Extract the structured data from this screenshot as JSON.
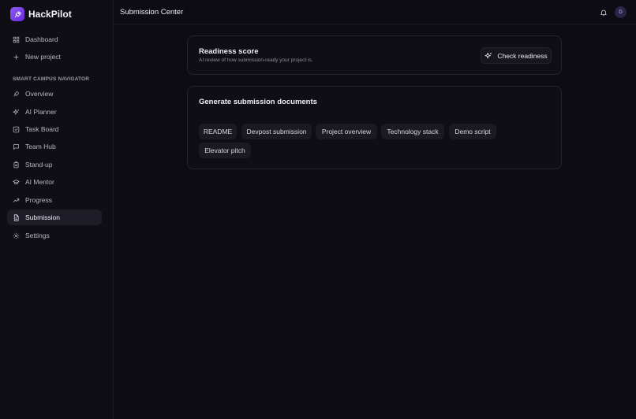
{
  "brand": {
    "name": "HackPilot",
    "logo_icon": "rocket-icon",
    "accent": "#8b5cf6"
  },
  "sidebar": {
    "top_items": [
      {
        "label": "Dashboard",
        "icon": "grid-icon"
      },
      {
        "label": "New project",
        "icon": "plus-icon"
      }
    ],
    "section_label": "SMART CAMPUS NAVIGATOR",
    "project_items": [
      {
        "label": "Overview",
        "icon": "rocket-icon"
      },
      {
        "label": "AI Planner",
        "icon": "sparkles-icon"
      },
      {
        "label": "Task Board",
        "icon": "checklist-icon"
      },
      {
        "label": "Team Hub",
        "icon": "chat-icon"
      },
      {
        "label": "Stand-up",
        "icon": "clipboard-icon"
      },
      {
        "label": "AI Mentor",
        "icon": "graduation-cap-icon"
      },
      {
        "label": "Progress",
        "icon": "trend-up-icon"
      },
      {
        "label": "Submission",
        "icon": "file-icon",
        "active": true
      },
      {
        "label": "Settings",
        "icon": "gear-icon"
      }
    ]
  },
  "header": {
    "title": "Submission Center",
    "avatar_initial": "D"
  },
  "readiness": {
    "title": "Readiness score",
    "subtitle": "AI review of how submission-ready your project is.",
    "button_label": "Check readiness"
  },
  "generate": {
    "title": "Generate submission documents",
    "documents": [
      "README",
      "Devpost submission",
      "Project overview",
      "Technology stack",
      "Demo script",
      "Elevator pitch"
    ]
  }
}
